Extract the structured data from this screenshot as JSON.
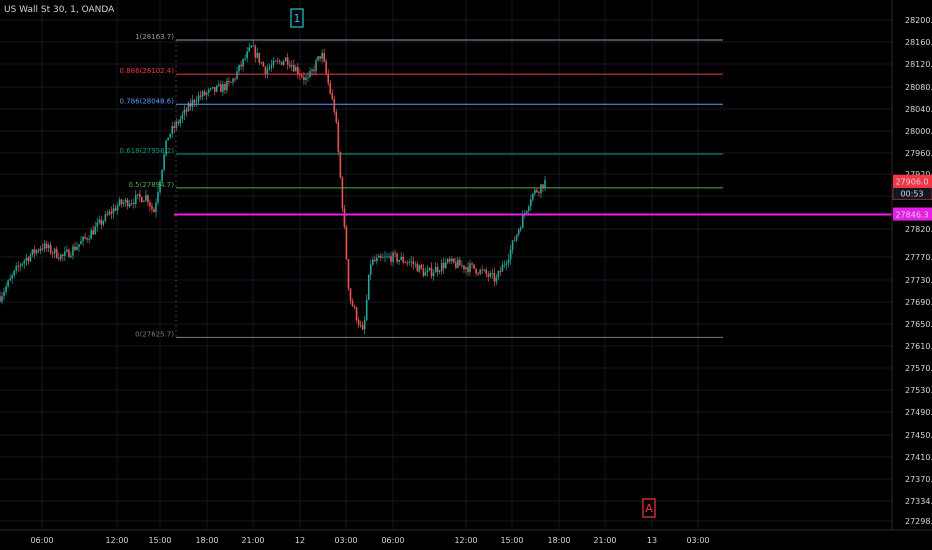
{
  "header": {
    "symbol_title": "US Wall St 30, 1, OANDA"
  },
  "chart_data": {
    "type": "candlestick",
    "title": "US Wall St 30, 1, OANDA",
    "x_ticks": [
      "06:00",
      "12:00",
      "15:00",
      "18:00",
      "21:00",
      "12",
      "03:00",
      "06:00",
      "12:00",
      "15:00",
      "18:00",
      "21:00",
      "13",
      "03:00"
    ],
    "y_ticks": [
      28200.0,
      28160.0,
      28120.0,
      28080.0,
      28040.0,
      28000.0,
      27960.0,
      27920.0,
      27880.0,
      27820.0,
      27770.0,
      27730.0,
      27690.0,
      27650.0,
      27610.0,
      27570.0,
      27530.0,
      27490.0,
      27450.0,
      27410.0,
      27370.0,
      27334.0,
      27298.0
    ],
    "y_tick_labels": [
      "28200.0",
      "28160.0",
      "28120.0",
      "28080.0",
      "28040.0",
      "28000.0",
      "27960.0",
      "27920.0",
      "27880.0",
      "27820.0",
      "27770.0",
      "27730.0",
      "27690.0",
      "27650.0",
      "27610.0",
      "27570.0",
      "27530.0",
      "27490.0",
      "27450.0",
      "27410.0",
      "27370.0",
      "27334.0",
      "27298.0"
    ],
    "ylim": [
      27280,
      28220
    ],
    "fib_levels": [
      {
        "ratio": "1",
        "price": 28163.7,
        "label": "1(28163.7)",
        "color": "#9598a1"
      },
      {
        "ratio": "0.886",
        "price": 28102.4,
        "label": "0.886(28102.4)",
        "color": "#f23645"
      },
      {
        "ratio": "0.786",
        "price": 28048.6,
        "label": "0.786(28048.6)",
        "color": "#5b9cf6"
      },
      {
        "ratio": "0.618",
        "price": 27958.2,
        "label": "0.618(27958.2)",
        "color": "#089981"
      },
      {
        "ratio": "0.5",
        "price": 27894.7,
        "label": "0.5(27894.7)",
        "color": "#4caf50"
      },
      {
        "ratio": "0",
        "price": 27625.7,
        "label": "0(27625.7)",
        "color": "#787b86"
      }
    ],
    "horizontal_line": {
      "price": 27846.3,
      "label": "27846.3",
      "color": "#e81ee8"
    },
    "current_price": {
      "price": 27906.0,
      "label": "27906.0",
      "countdown": "00:53",
      "color": "#f23645"
    },
    "wave_markers": [
      {
        "label": "1",
        "color": "#26c6da"
      },
      {
        "label": "A",
        "color": "#f23645"
      }
    ],
    "price_path": [
      [
        0,
        27700
      ],
      [
        0.03,
        27760
      ],
      [
        0.06,
        27790
      ],
      [
        0.09,
        27770
      ],
      [
        0.12,
        27800
      ],
      [
        0.17,
        27865
      ],
      [
        0.21,
        27880
      ],
      [
        0.22,
        27850
      ],
      [
        0.24,
        27990
      ],
      [
        0.28,
        28060
      ],
      [
        0.33,
        28085
      ],
      [
        0.36,
        28150
      ],
      [
        0.38,
        28110
      ],
      [
        0.41,
        28130
      ],
      [
        0.44,
        28090
      ],
      [
        0.46,
        28140
      ],
      [
        0.48,
        28030
      ],
      [
        0.5,
        27700
      ],
      [
        0.52,
        27630
      ],
      [
        0.53,
        27760
      ],
      [
        0.56,
        27770
      ],
      [
        0.59,
        27760
      ],
      [
        0.61,
        27740
      ],
      [
        0.64,
        27760
      ],
      [
        0.68,
        27750
      ],
      [
        0.71,
        27730
      ],
      [
        0.73,
        27780
      ],
      [
        0.76,
        27880
      ],
      [
        0.78,
        27906
      ]
    ],
    "colors": {
      "up": "#26a69a",
      "down": "#ef5350",
      "background": "#000000",
      "text": "#d1d4dc"
    }
  }
}
